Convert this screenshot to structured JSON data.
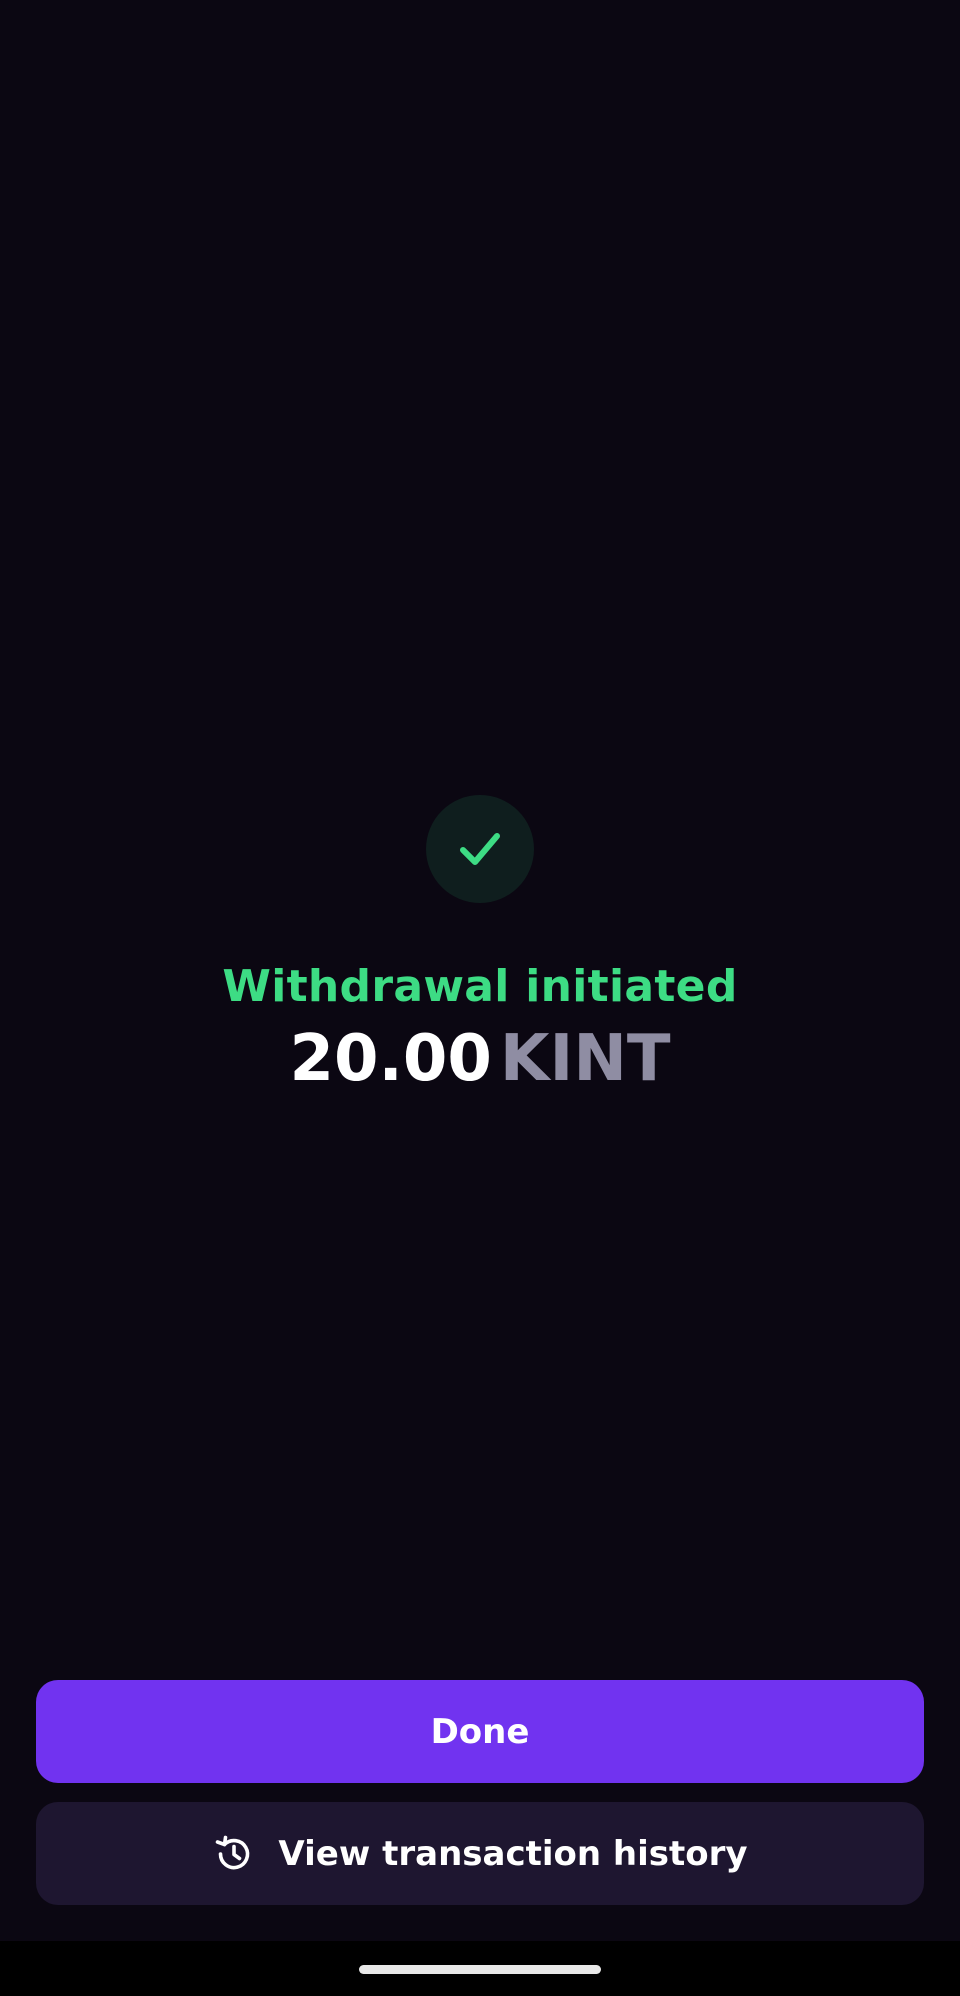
{
  "status": {
    "icon": "checkmark-icon",
    "title": "Withdrawal initiated",
    "title_color": "#3ddc84"
  },
  "amount": {
    "value": "20.00",
    "unit": "KINT"
  },
  "actions": {
    "done_label": "Done",
    "history_label": "View transaction history",
    "history_icon": "history-icon",
    "primary_color": "#7133f0",
    "secondary_color": "#1e1630"
  },
  "theme": {
    "background": "#0b0712"
  }
}
